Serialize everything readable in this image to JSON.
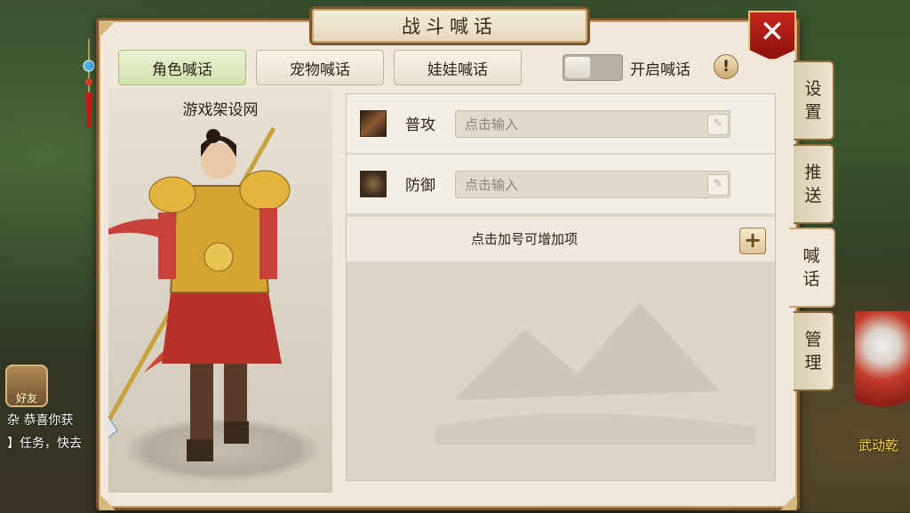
{
  "panel": {
    "title": "战斗喊话",
    "close_label": "✕"
  },
  "tabs": [
    {
      "label": "角色喊话",
      "active": true
    },
    {
      "label": "宠物喊话",
      "active": false
    },
    {
      "label": "娃娃喊话",
      "active": false
    }
  ],
  "shout_toggle": {
    "label": "开启喊话",
    "enabled": false
  },
  "help_label": "!",
  "portrait": {
    "title": "游戏架设网"
  },
  "skills": [
    {
      "name": "普攻",
      "placeholder": "点击输入",
      "icon": "sword-icon"
    },
    {
      "name": "防御",
      "placeholder": "点击输入",
      "icon": "armor-icon"
    }
  ],
  "add_hint": "点击加号可增加项",
  "add_label": "+",
  "side_tabs": [
    {
      "label1": "设",
      "label2": "置",
      "active": false
    },
    {
      "label1": "推",
      "label2": "送",
      "active": false
    },
    {
      "label1": "喊",
      "label2": "话",
      "active": true
    },
    {
      "label1": "管",
      "label2": "理",
      "active": false
    }
  ],
  "background": {
    "friend_label": "好友",
    "chat_line_1": "杂  恭喜你获",
    "chat_line_2": "】任务，快去",
    "npc_name": "武动乾"
  },
  "colors": {
    "accent_green": "#cfe0ab",
    "close_red": "#c4251c",
    "frame_brown": "#7a5630"
  }
}
